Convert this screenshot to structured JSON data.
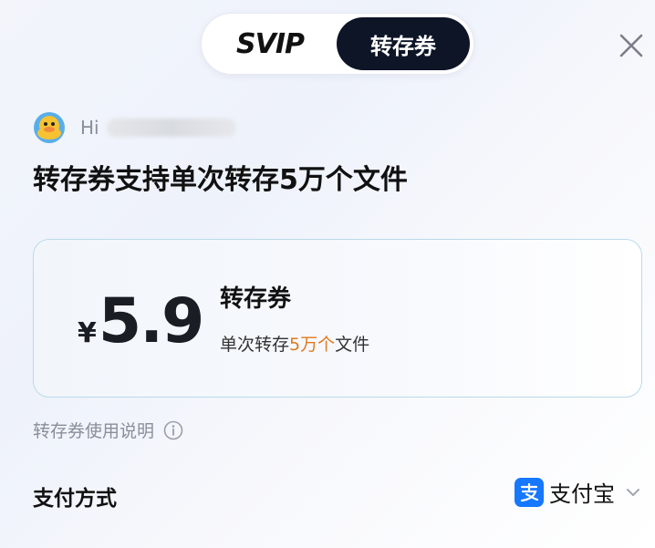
{
  "tabs": {
    "svip_label": "SVIP",
    "coupon_label": "转存券",
    "active": "coupon"
  },
  "greeting": {
    "hi": "Hi"
  },
  "headline": "转存券支持单次转存5万个文件",
  "card": {
    "currency": "¥",
    "price": "5.9",
    "title": "转存券",
    "desc_prefix": "单次转存",
    "desc_highlight": "5万个",
    "desc_suffix": "文件"
  },
  "info": {
    "label": "转存券使用说明"
  },
  "payment": {
    "label": "支付方式",
    "method": "支付宝"
  },
  "colors": {
    "active_tab_bg": "#0d1526",
    "highlight": "#e0791f",
    "card_border": "#b8dbe8",
    "alipay_blue": "#1677ff"
  },
  "icons": {
    "close": "close-icon",
    "avatar": "duck-avatar-icon",
    "info": "info-circle-icon",
    "alipay": "alipay-icon",
    "chevron": "chevron-down-icon"
  }
}
